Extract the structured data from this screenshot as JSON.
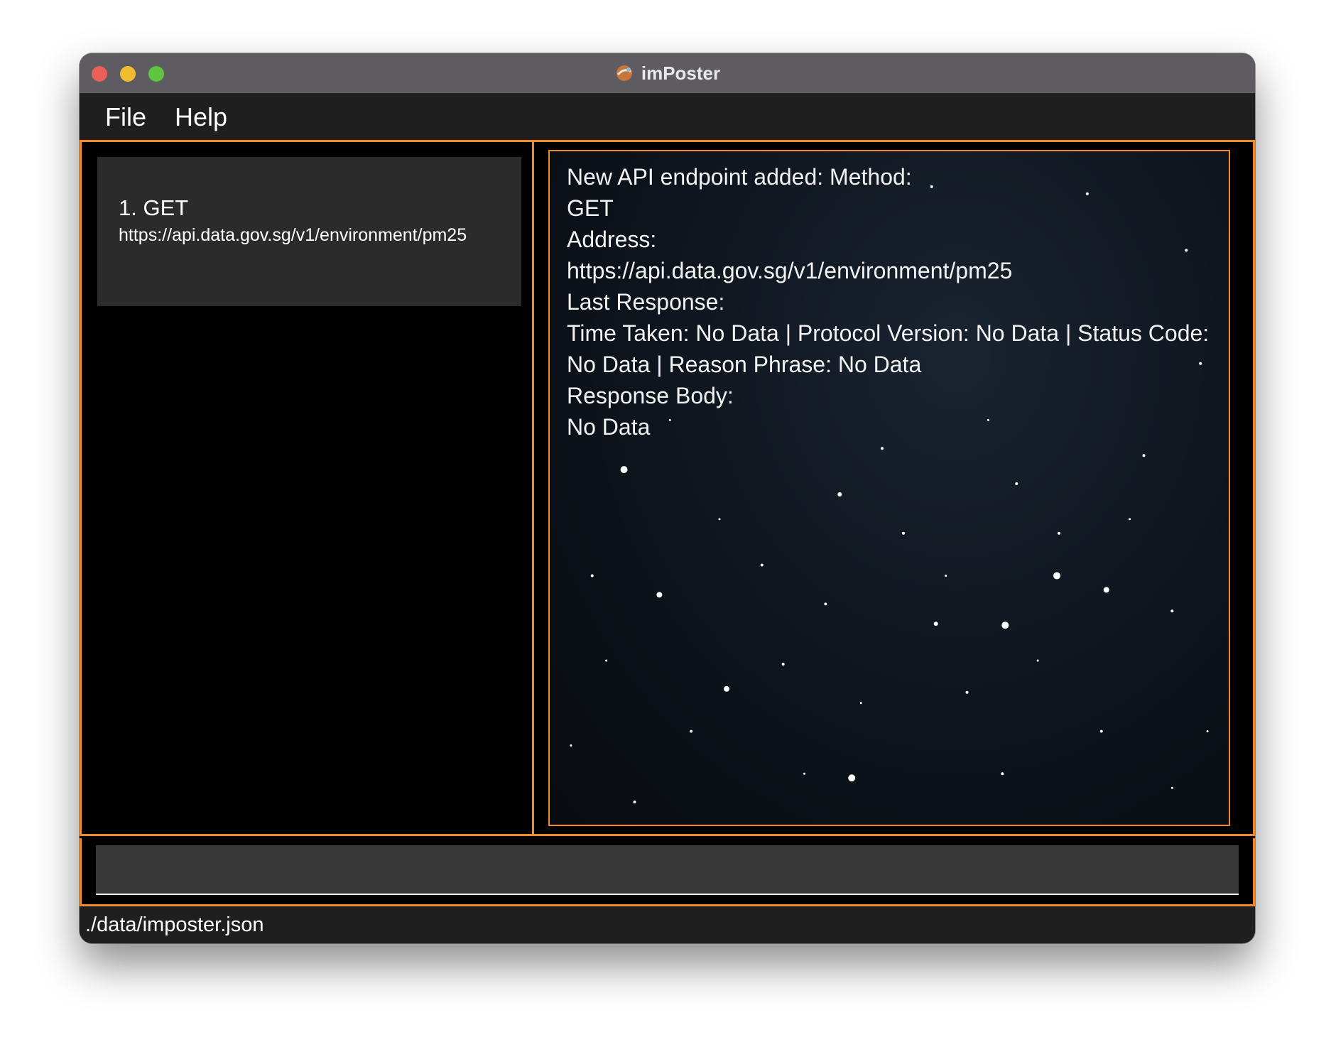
{
  "window": {
    "title": "imPoster"
  },
  "menu": {
    "file_label": "File",
    "help_label": "Help"
  },
  "endpoint_list": {
    "items": [
      {
        "index_method": "1.  GET",
        "address": "https://api.data.gov.sg/v1/environment/pm25"
      }
    ]
  },
  "result_display": {
    "lines": [
      "New API endpoint added: Method:",
      "GET",
      "Address:",
      "https://api.data.gov.sg/v1/environment/pm25",
      "Last Response:",
      "Time Taken: No Data | Protocol Version: No Data | Status Code:",
      "No Data | Reason Phrase: No Data",
      "Response Body:",
      "No Data"
    ]
  },
  "command_box": {
    "value": "",
    "placeholder": ""
  },
  "status_bar": {
    "file_path": "./data/imposter.json"
  },
  "colors": {
    "accent": "#f28a2a",
    "titlebar": "#5e5c61",
    "menubar": "#1f1f1f",
    "card": "#2b2b2b",
    "input": "#383838"
  }
}
